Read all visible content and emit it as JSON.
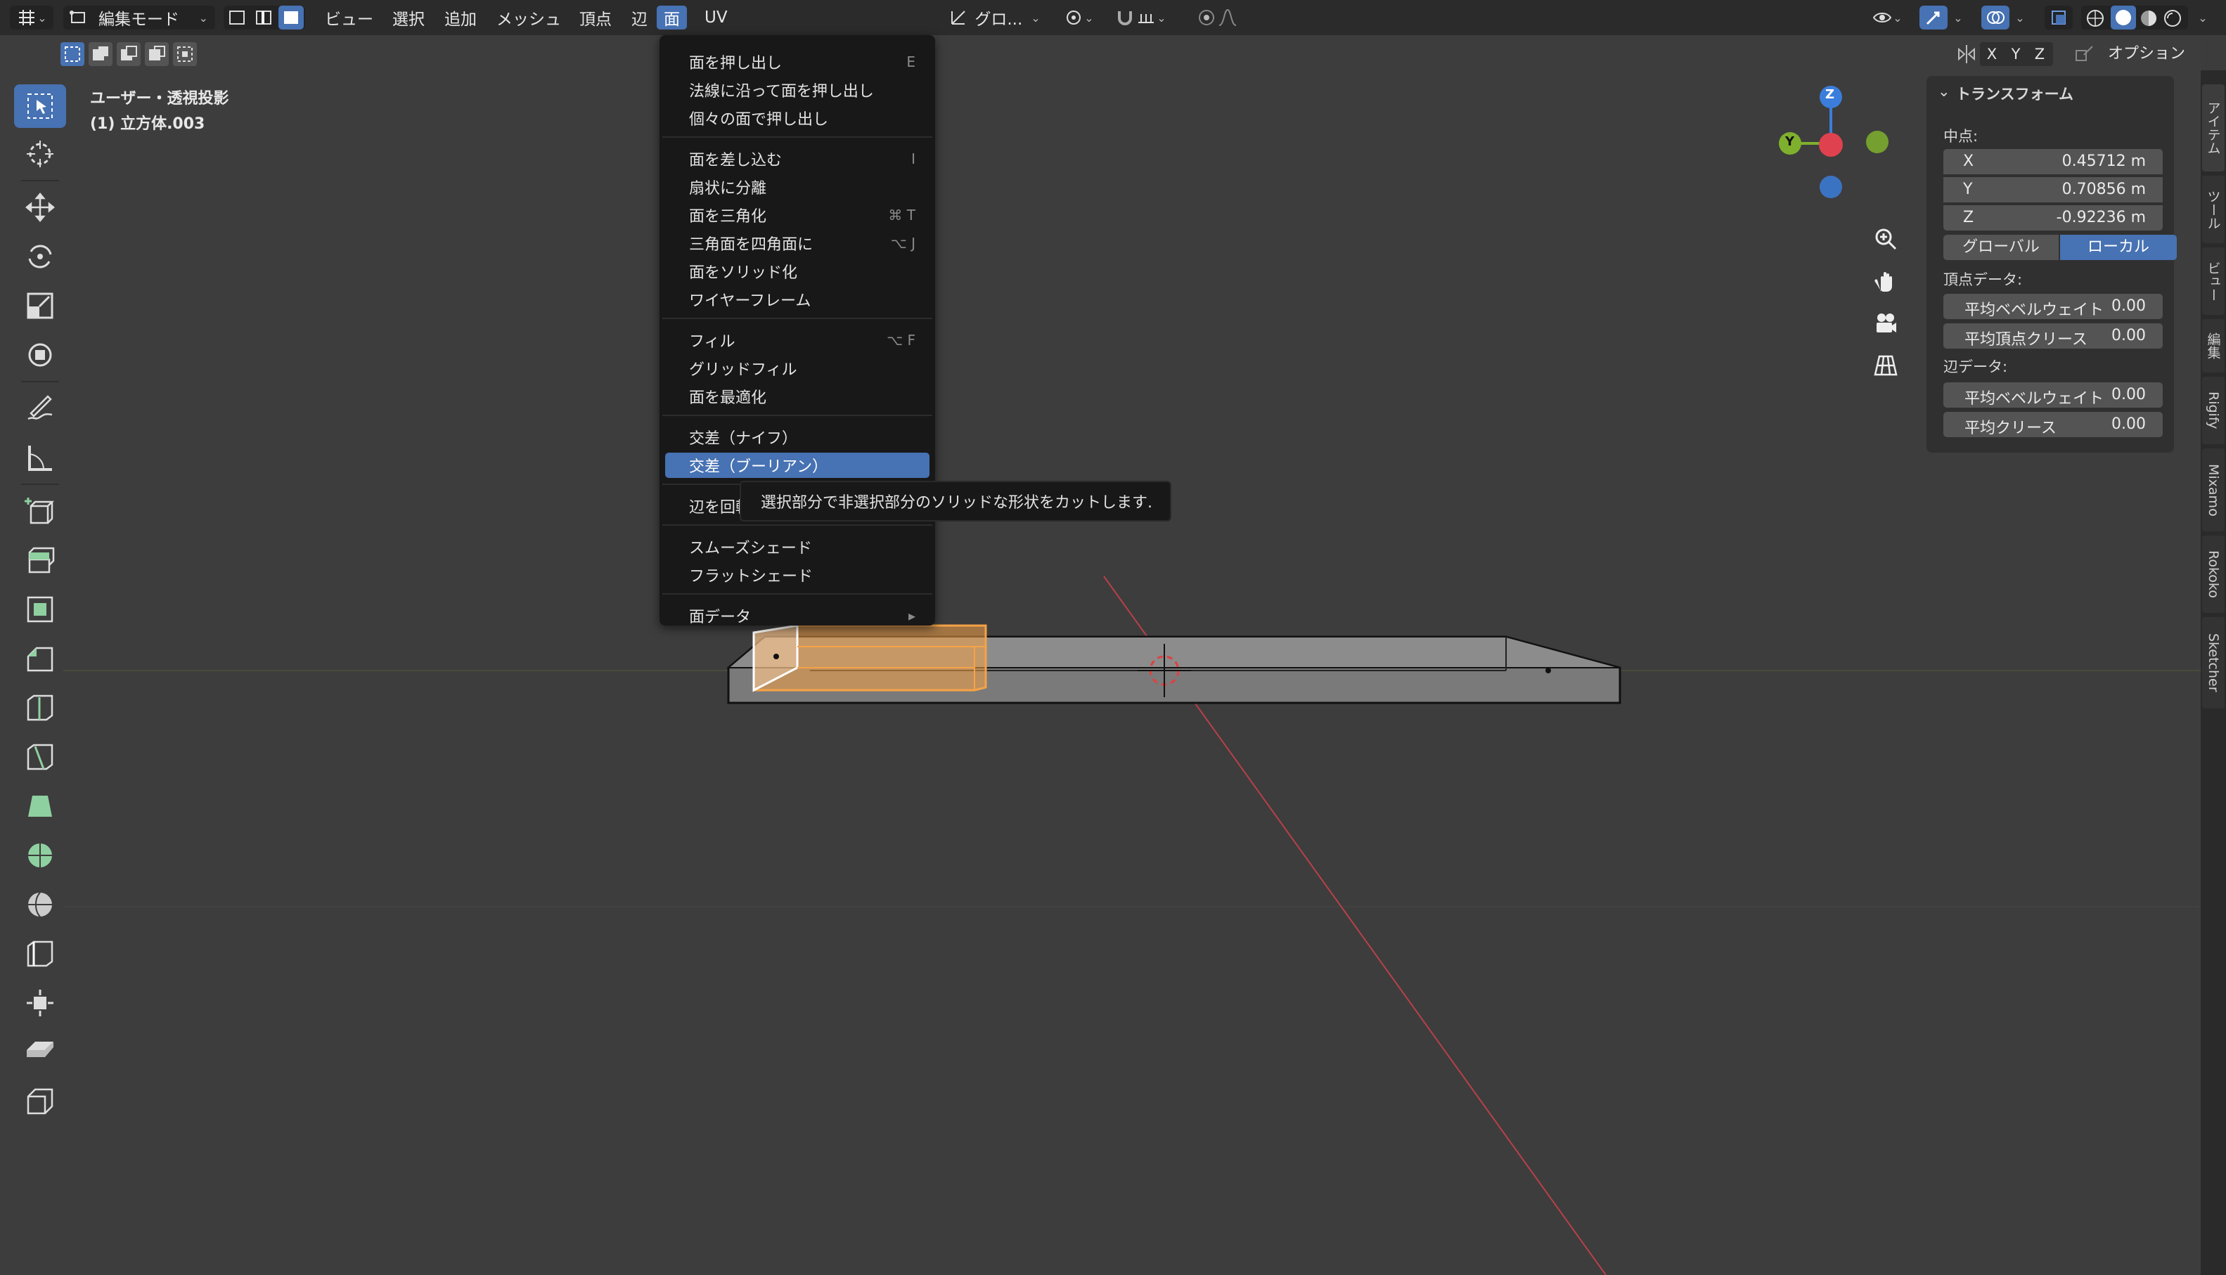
{
  "header": {
    "mode_label": "編集モード",
    "menus": [
      "ビュー",
      "選択",
      "追加",
      "メッシュ",
      "頂点",
      "辺",
      "面",
      "UV"
    ],
    "active_menu": "面",
    "orientation_label": "グロ...",
    "axis_x": "X",
    "axis_y": "Y",
    "axis_z": "Z",
    "options_label": "オプション"
  },
  "viewport": {
    "view_name": "ユーザー・透視投影",
    "object_name": "(1) 立方体.003",
    "gizmo_z": "Z",
    "gizmo_y": "Y"
  },
  "face_menu": {
    "groups": [
      [
        {
          "label": "面を押し出し",
          "shortcut": "E"
        },
        {
          "label": "法線に沿って面を押し出し",
          "shortcut": ""
        },
        {
          "label": "個々の面で押し出し",
          "shortcut": ""
        }
      ],
      [
        {
          "label": "面を差し込む",
          "shortcut": "I"
        },
        {
          "label": "扇状に分離",
          "shortcut": ""
        },
        {
          "label": "面を三角化",
          "shortcut": "⌘ T"
        },
        {
          "label": "三角面を四角面に",
          "shortcut": "⌥ J"
        },
        {
          "label": "面をソリッド化",
          "shortcut": ""
        },
        {
          "label": "ワイヤーフレーム",
          "shortcut": ""
        }
      ],
      [
        {
          "label": "フィル",
          "shortcut": "⌥ F"
        },
        {
          "label": "グリッドフィル",
          "shortcut": ""
        },
        {
          "label": "面を最適化",
          "shortcut": ""
        }
      ],
      [
        {
          "label": "交差（ナイフ）",
          "shortcut": ""
        },
        {
          "label": "交差（ブーリアン）",
          "shortcut": "",
          "highlighted": true
        }
      ],
      [
        {
          "label": "辺を回転",
          "shortcut": ""
        }
      ],
      [
        {
          "label": "スムーズシェード",
          "shortcut": ""
        },
        {
          "label": "フラットシェード",
          "shortcut": ""
        }
      ],
      [
        {
          "label": "面データ",
          "shortcut": "▸"
        }
      ]
    ],
    "tooltip": "選択部分で非選択部分のソリッドな形状をカットします."
  },
  "npanel": {
    "section_title": "トランスフォーム",
    "median_label": "中点:",
    "x_label": "X",
    "x_value": "0.45712 m",
    "y_label": "Y",
    "y_value": "0.70856 m",
    "z_label": "Z",
    "z_value": "-0.92236 m",
    "global_label": "グローバル",
    "local_label": "ローカル",
    "vertex_data_label": "頂点データ:",
    "vertex_bevel_label": "平均ベベルウェイト",
    "vertex_bevel_value": "0.00",
    "vertex_crease_label": "平均頂点クリース",
    "vertex_crease_value": "0.00",
    "edge_data_label": "辺データ:",
    "edge_bevel_label": "平均ベベルウェイト",
    "edge_bevel_value": "0.00",
    "edge_crease_label": "平均クリース",
    "edge_crease_value": "0.00"
  },
  "side_tabs": [
    "アイテム",
    "ツール",
    "ビュー",
    "編集",
    "Rigify",
    "Mixamo",
    "Rokoko",
    "Sketcher"
  ],
  "colors": {
    "accent": "#4772b3",
    "selection": "#f5a347",
    "axis_x": "#e0414f",
    "axis_y": "#7fb02d",
    "axis_z": "#3b7ddb"
  }
}
